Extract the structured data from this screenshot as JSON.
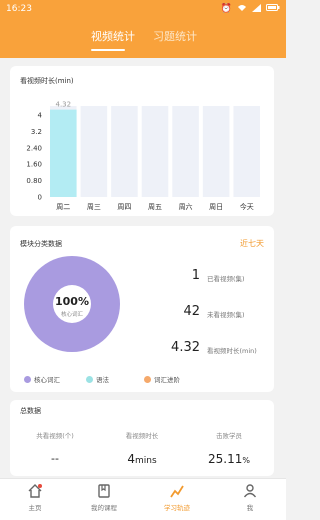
{
  "status": {
    "time": "16:23",
    "battery": "100%"
  },
  "tabs": [
    {
      "label": "视频统计"
    },
    {
      "label": "习题统计"
    }
  ],
  "watch_card": {
    "title": "看视频时长(min)"
  },
  "chart_data": {
    "type": "bar",
    "title": "看视频时长(min)",
    "categories": [
      "周二",
      "周三",
      "周四",
      "周五",
      "周六",
      "周日",
      "今天"
    ],
    "values": [
      4.32,
      0,
      0,
      0,
      0,
      0,
      0
    ],
    "data_labels": [
      "4.32",
      "",
      "",
      "",
      "",
      "",
      ""
    ],
    "yticks": [
      "4",
      "3.2",
      "2.40",
      "1.60",
      "0.80",
      "0"
    ],
    "ylim": [
      0,
      4.5
    ],
    "colors": {
      "bar": "#b3ecf3",
      "bg": "#eef1f8"
    }
  },
  "module_card": {
    "title": "模块分类数据",
    "range": "近七天",
    "donut_percent": "100%",
    "donut_label": "核心词汇",
    "stats": [
      {
        "value": "1",
        "label": "已看视频(集)"
      },
      {
        "value": "42",
        "label": "未看视频(集)"
      },
      {
        "value": "4.32",
        "label": "看视频时长(min)"
      }
    ],
    "legend": [
      {
        "label": "核心词汇",
        "color": "#a99be0"
      },
      {
        "label": "语法",
        "color": "#9be2e4"
      },
      {
        "label": "词汇进阶",
        "color": "#f5a96b"
      }
    ]
  },
  "summary_card": {
    "title": "总数据",
    "items": [
      {
        "label": "共看视频(个)",
        "value": "--"
      },
      {
        "label": "看视频时长",
        "value": "4",
        "unit": "mins"
      },
      {
        "label": "击败学员",
        "value": "25.11",
        "unit": "%"
      }
    ]
  },
  "bottom_nav": [
    {
      "label": "主页",
      "icon": "home-icon"
    },
    {
      "label": "我的课程",
      "icon": "book-icon"
    },
    {
      "label": "学习轨迹",
      "icon": "trend-icon"
    },
    {
      "label": "我",
      "icon": "user-icon"
    }
  ],
  "accent_color": "#f9a23b"
}
